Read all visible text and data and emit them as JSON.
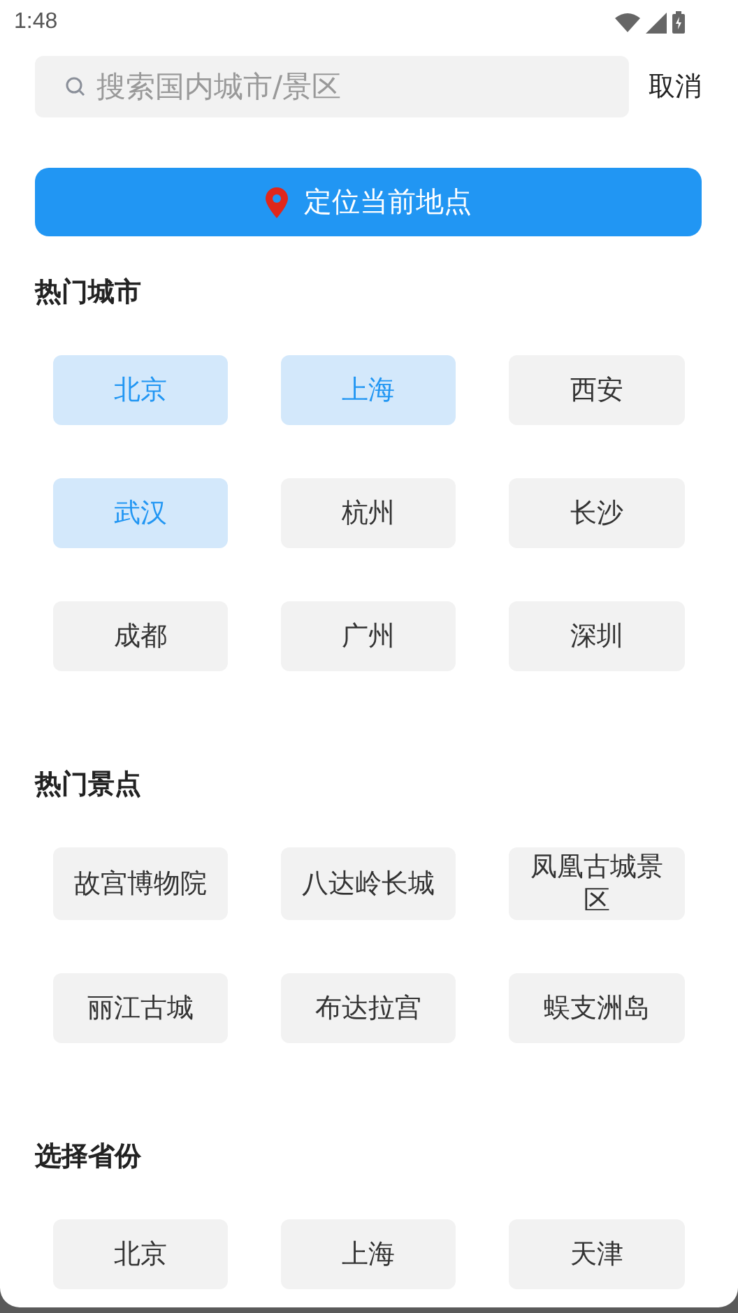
{
  "status_bar": {
    "time": "1:48"
  },
  "search": {
    "placeholder": "搜索国内城市/景区",
    "cancel": "取消"
  },
  "locate_button": {
    "label": "定位当前地点"
  },
  "sections": [
    {
      "title": "热门城市",
      "items": [
        {
          "label": "北京",
          "selected": true
        },
        {
          "label": "上海",
          "selected": true
        },
        {
          "label": "西安",
          "selected": false
        },
        {
          "label": "武汉",
          "selected": true
        },
        {
          "label": "杭州",
          "selected": false
        },
        {
          "label": "长沙",
          "selected": false
        },
        {
          "label": "成都",
          "selected": false
        },
        {
          "label": "广州",
          "selected": false
        },
        {
          "label": "深圳",
          "selected": false
        }
      ]
    },
    {
      "title": "热门景点",
      "items": [
        {
          "label": "故宫博物院",
          "selected": false
        },
        {
          "label": "八达岭长城",
          "selected": false
        },
        {
          "label": "凤凰古城景区",
          "selected": false
        },
        {
          "label": "丽江古城",
          "selected": false
        },
        {
          "label": "布达拉宫",
          "selected": false
        },
        {
          "label": "蜈支洲岛",
          "selected": false
        }
      ]
    },
    {
      "title": "选择省份",
      "items": [
        {
          "label": "北京",
          "selected": false
        },
        {
          "label": "上海",
          "selected": false
        },
        {
          "label": "天津",
          "selected": false
        }
      ]
    }
  ]
}
